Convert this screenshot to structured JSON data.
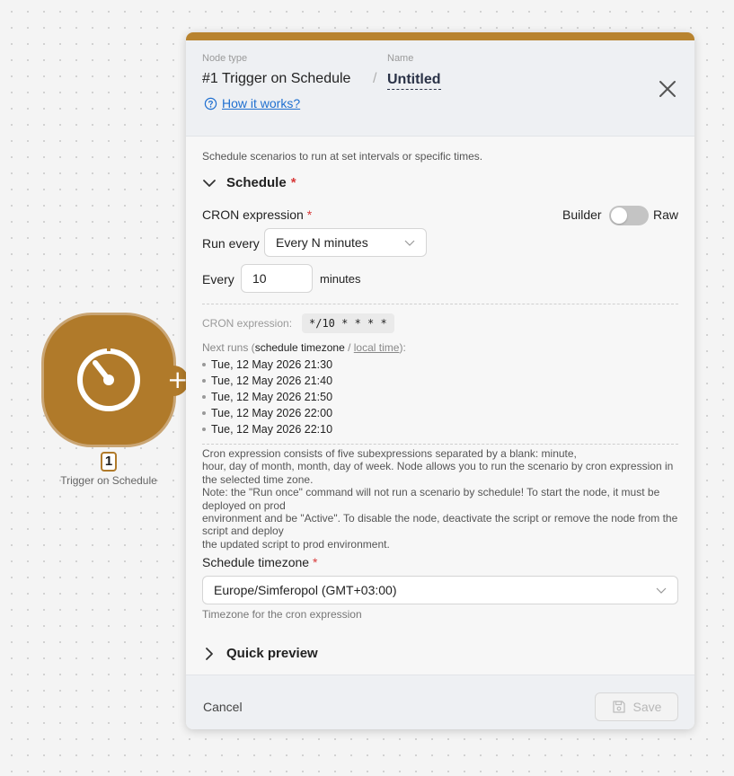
{
  "node": {
    "badge": "1",
    "label": "Trigger on Schedule",
    "color": "#b07a2a",
    "icon": "timer-icon",
    "add_icon": "plus-icon"
  },
  "panel": {
    "accent": "#b8832f",
    "header": {
      "node_type_label": "Node type",
      "node_type_value": "#1 Trigger on Schedule",
      "name_label": "Name",
      "name_value": "Untitled",
      "help_link": "How it works?",
      "separator": "/"
    },
    "description": "Schedule scenarios to run at set intervals or specific times.",
    "schedule_section": {
      "title": "Schedule",
      "required_mark": "*",
      "expanded": true,
      "cron_label": "CRON expression",
      "mode_builder": "Builder",
      "mode_raw": "Raw",
      "mode_is_raw": false,
      "run_every_label": "Run every",
      "run_every_value": "Every N minutes",
      "every_label": "Every",
      "every_value": "10",
      "minutes_label": "minutes",
      "cron_expression_label": "CRON expression:",
      "cron_expression_value": "*/10 * * * *",
      "next_runs_prefix": "Next runs (",
      "next_runs_schedule_tz": "schedule timezone",
      "next_runs_sep": " / ",
      "next_runs_local": "local time",
      "next_runs_suffix": "):",
      "next_runs": [
        "Tue, 12 May 2026 21:30",
        "Tue, 12 May 2026 21:40",
        "Tue, 12 May 2026 21:50",
        "Tue, 12 May 2026 22:00",
        "Tue, 12 May 2026 22:10"
      ],
      "help_lines": [
        "Cron expression consists of five subexpressions separated by a blank: minute,",
        "hour, day of month, month, day of week. Node allows you to run the scenario by cron expression in the selected time zone.",
        "Note: the \"Run once\" command will not run a scenario by schedule! To start the node, it must be deployed on prod",
        "environment and be \"Active\". To disable the node, deactivate the script or remove the node from the script and deploy",
        "the updated script to prod environment."
      ],
      "timezone_label": "Schedule timezone",
      "timezone_value": "Europe/Simferopol (GMT+03:00)",
      "timezone_hint": "Timezone for the cron expression"
    },
    "quick_preview": {
      "title": "Quick preview",
      "expanded": false
    },
    "footer": {
      "cancel": "Cancel",
      "save": "Save"
    }
  }
}
